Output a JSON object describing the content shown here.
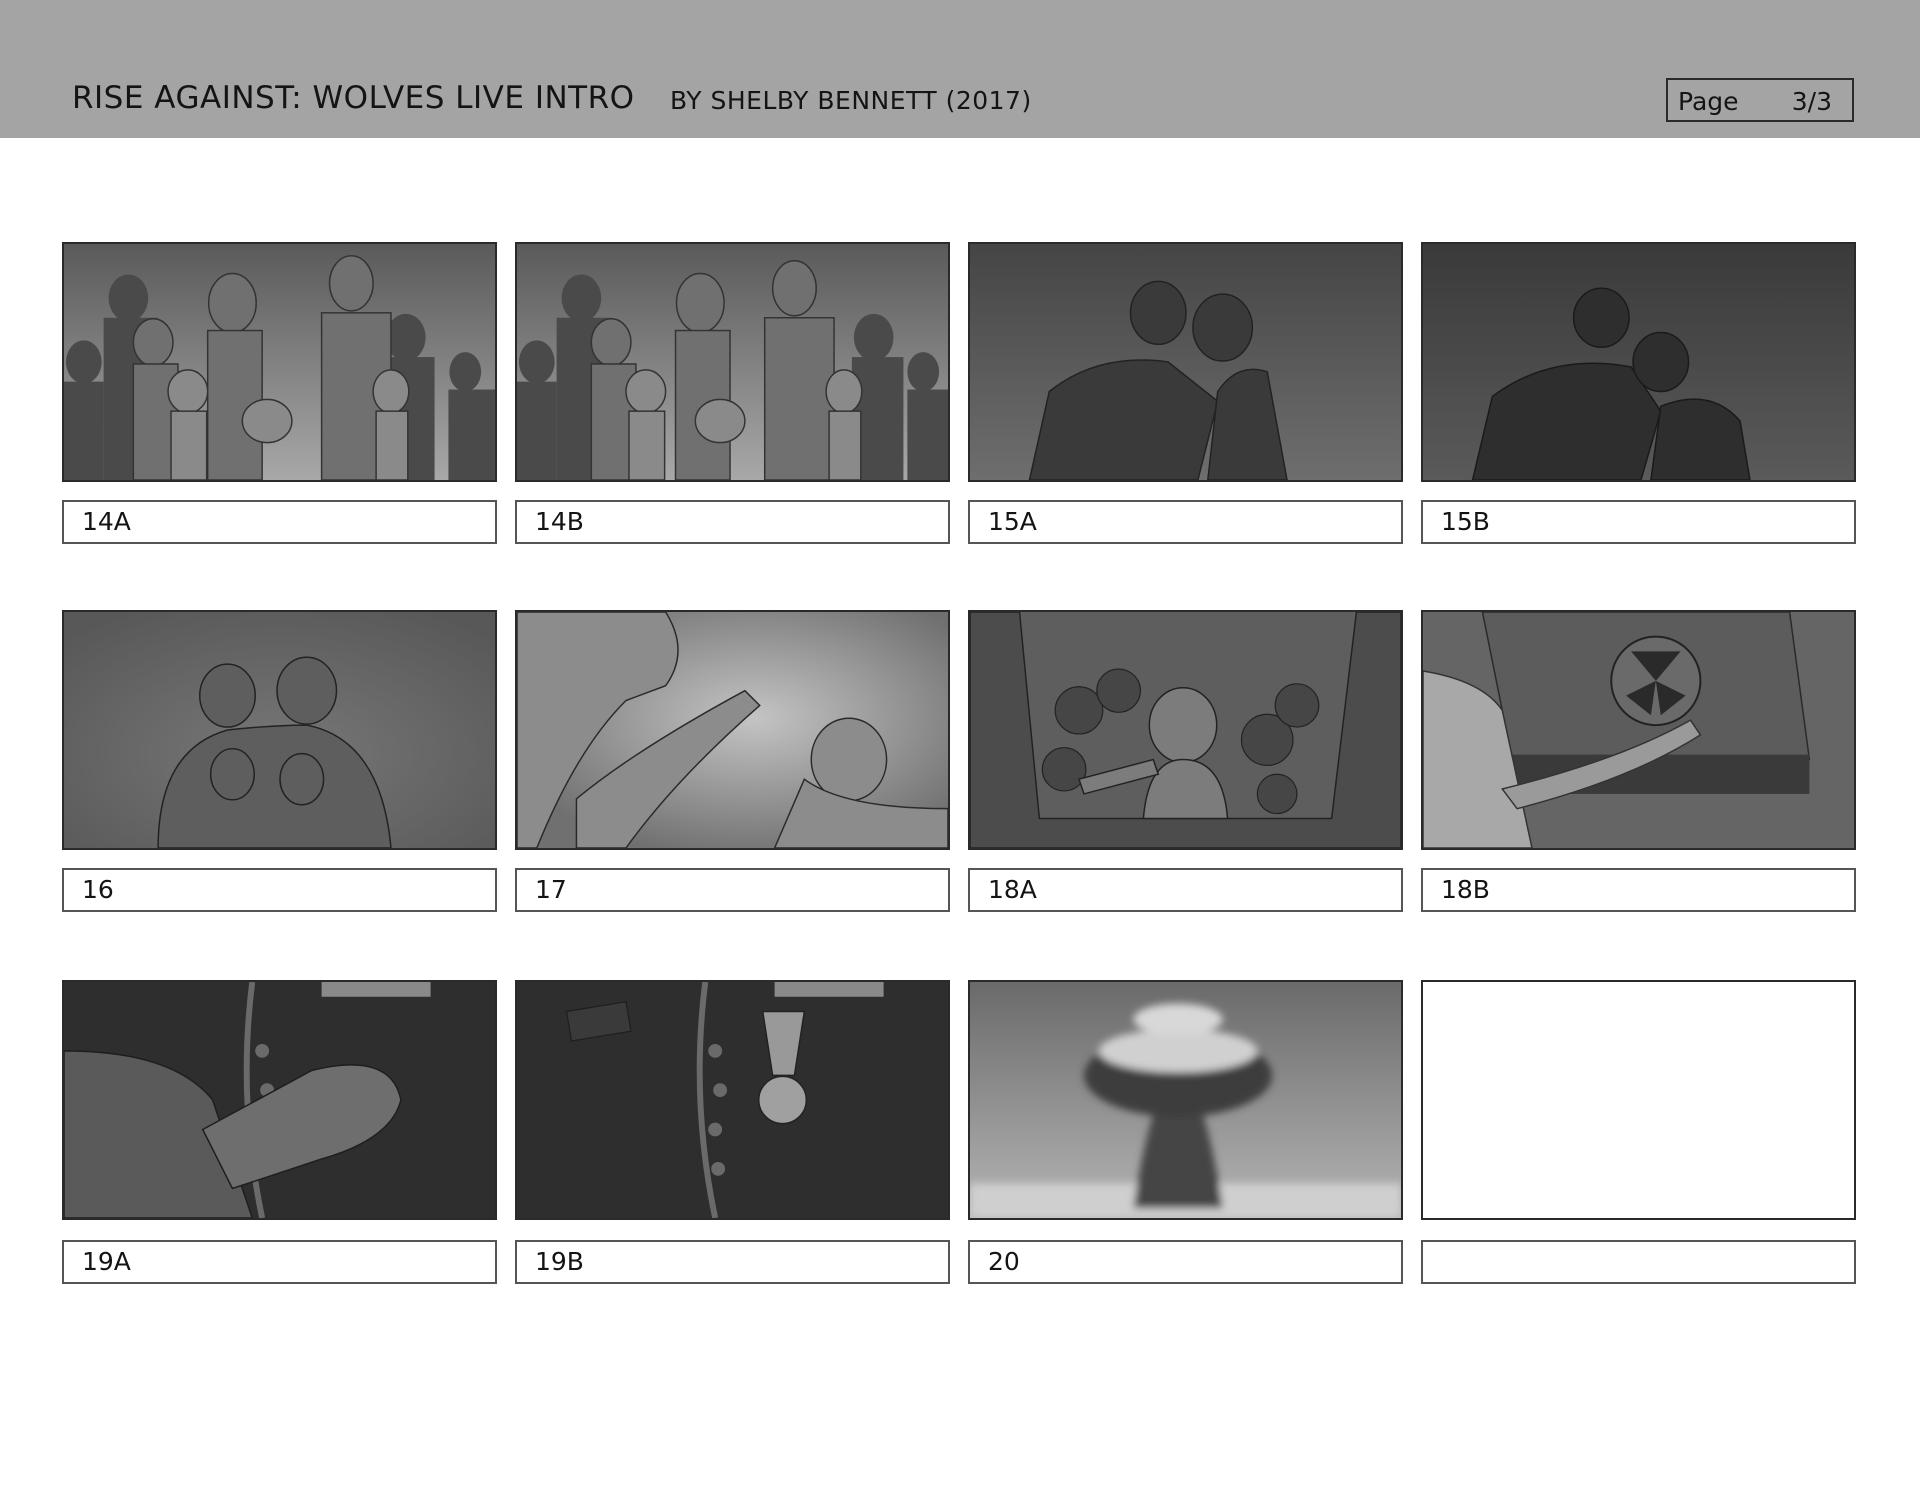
{
  "header": {
    "title": "RISE AGAINST: WOLVES LIVE INTRO",
    "byline": "BY SHELBY BENNETT (2017)",
    "page_label": "Page",
    "page_number": "3/3"
  },
  "panels": [
    {
      "label": "14A",
      "scene": "crowd-worried-family"
    },
    {
      "label": "14B",
      "scene": "crowd-turning-heads"
    },
    {
      "label": "15A",
      "scene": "father-embracing-child-in-gas-mask"
    },
    {
      "label": "15B",
      "scene": "father-hugging-child-close"
    },
    {
      "label": "16",
      "scene": "parents-hugging-children-in-gas-masks"
    },
    {
      "label": "17",
      "scene": "hands-clasped-farewell"
    },
    {
      "label": "18A",
      "scene": "girl-reaching-out-in-shelter"
    },
    {
      "label": "18B",
      "scene": "hand-closing-fallout-shelter-hatch"
    },
    {
      "label": "19A",
      "scene": "hand-pressing-control-button"
    },
    {
      "label": "19B",
      "scene": "uniform-with-medal"
    },
    {
      "label": "20",
      "scene": "mushroom-cloud-explosion"
    },
    {
      "label": "",
      "scene": "blank-panel"
    }
  ]
}
